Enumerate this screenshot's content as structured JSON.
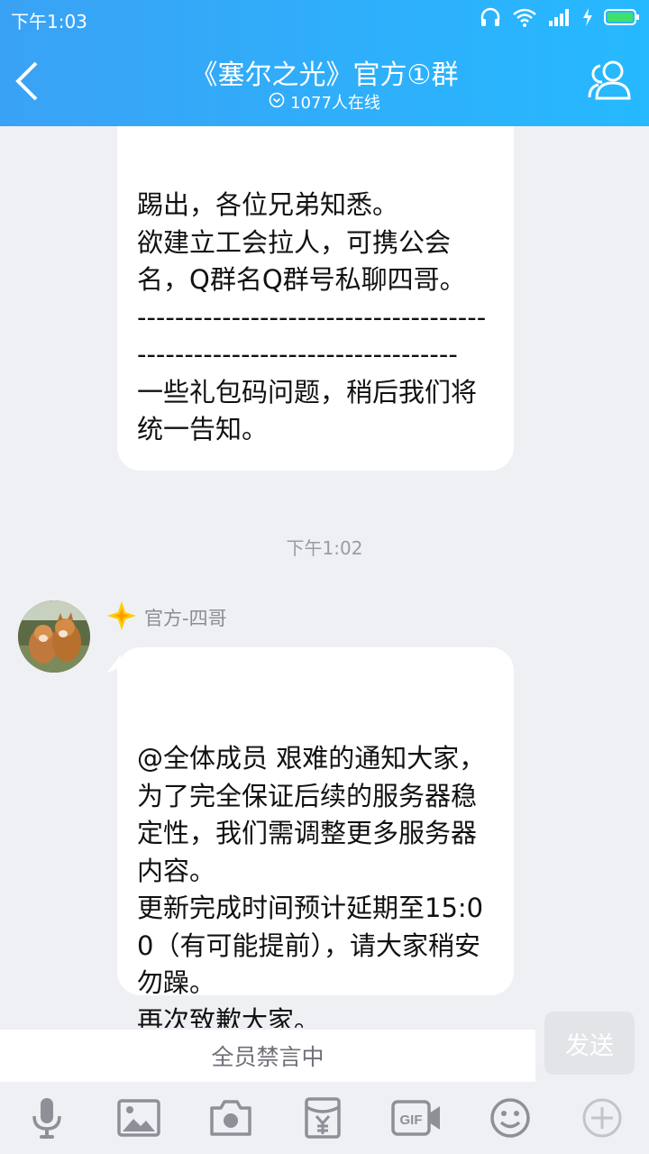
{
  "status": {
    "time": "下午1:03"
  },
  "header": {
    "title": "《塞尔之光》官方①群",
    "online": "1077人在线"
  },
  "messages": {
    "first_text": "踢出，各位兄弟知悉。\n欲建立工会拉人，可携公会名，Q群名Q群号私聊四哥。\n-----------------------------------------------------------------------\n一些礼包码问题，稍后我们将统一告知。",
    "timestamp": "下午1:02",
    "sender": "官方-四哥",
    "second_text": "@全体成员 艰难的通知大家，为了完全保证后续的服务器稳定性，我们需调整更多服务器内容。\n更新完成时间预计延期至15:00（有可能提前），请大家稍安勿躁。\n再次致歉大家。"
  },
  "input": {
    "muted_text": "全员禁言中",
    "send_label": "发送"
  },
  "colors": {
    "header_start": "#3aa2f5",
    "header_end": "#26b9ff",
    "background": "#eef0f4",
    "icon_gray": "#8d9097"
  },
  "toolbar_icons": [
    "microphone-icon",
    "image-icon",
    "camera-icon",
    "red-packet-icon",
    "gif-icon",
    "emoji-icon",
    "plus-icon"
  ]
}
